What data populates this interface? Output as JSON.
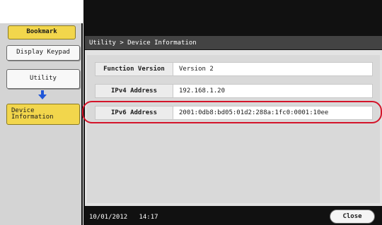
{
  "sidebar": {
    "bookmark_label": "Bookmark",
    "display_keypad_label": "Display Keypad",
    "utility_label": "Utility",
    "device_information_line1": "Device",
    "device_information_line2": "Information"
  },
  "header": {
    "breadcrumb": "Utility > Device Information"
  },
  "info_rows": [
    {
      "label": "Function Version",
      "value": "Version 2"
    },
    {
      "label": "IPv4 Address",
      "value": "192.168.1.20"
    },
    {
      "label": "IPv6 Address",
      "value": "2001:0db8:bd05:01d2:288a:1fc0:0001:10ee"
    }
  ],
  "status": {
    "date": "10/01/2012",
    "time": "14:17"
  },
  "footer": {
    "close_label": "Close"
  },
  "colors": {
    "accent_yellow": "#f2d64c",
    "highlight_red": "#d4142a",
    "arrow_blue": "#1f56d8"
  },
  "icons": {
    "flow_arrow": "arrow-down-icon"
  }
}
